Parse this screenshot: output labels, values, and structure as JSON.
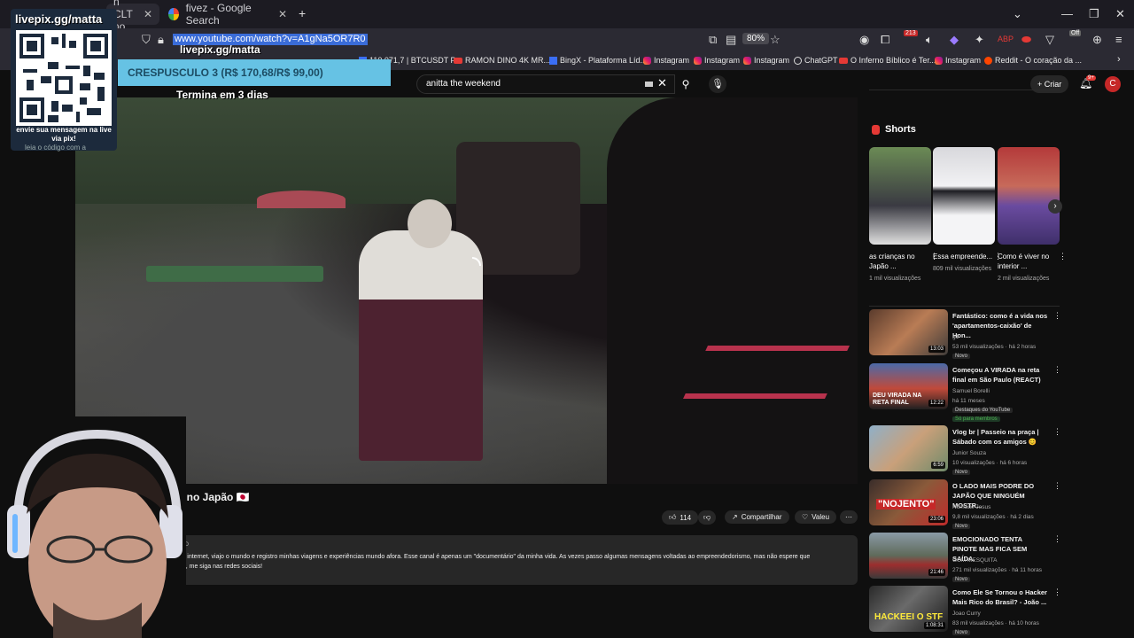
{
  "browser": {
    "tabs": [
      {
        "label": "n CLT no"
      },
      {
        "label": "fivez - Google Search"
      }
    ],
    "new_tab": "+",
    "url": "www.youtube.com/watch?v=A1gNa5OR7R0",
    "zoom": "80%",
    "ext_badge_1": "213",
    "ext_badge_2": "Off",
    "bookmarks": [
      {
        "label": "110.071,7 | BTCUSDT P...",
        "icon": "chart-icon"
      },
      {
        "label": "RAMON DINO 4K MR...",
        "icon": "youtube-icon"
      },
      {
        "label": "BingX - Plataforma Líd...",
        "icon": "bingx-icon"
      },
      {
        "label": "Instagram",
        "icon": "instagram-icon"
      },
      {
        "label": "Instagram",
        "icon": "instagram-icon"
      },
      {
        "label": "Instagram",
        "icon": "instagram-icon"
      },
      {
        "label": "ChatGPT",
        "icon": "chatgpt-icon"
      },
      {
        "label": "O Inferno Bíblico é Ter...",
        "icon": "youtube-icon"
      },
      {
        "label": "Instagram",
        "icon": "instagram-icon"
      },
      {
        "label": "Reddit - O coração da ...",
        "icon": "reddit-icon"
      }
    ]
  },
  "youtube": {
    "search_value": "anitta the weekend",
    "create_label": "Criar",
    "notif_count": "9+",
    "avatar_letter": "C",
    "video": {
      "title_fragment": "T no Japão 🇯🇵",
      "likes": "114",
      "share_label": "Compartilhar",
      "thanks_label": "Valeu",
      "desc_top": "OTO",
      "description": "ela internet, viajo o mundo e registro minhas viagens e experiências mundo afora. Esse canal é apenas um \"documentário\" da minha vida. As vezes passo algumas mensagens voltadas ao empreendedorismo, mas não espere que",
      "description_2": "rtiu, me siga nas redes sociais!"
    },
    "shorts_heading": "Shorts",
    "shorts": [
      {
        "title": "as crianças no Japão ...",
        "views": "1 mil visualizações"
      },
      {
        "title": "Essa empreende...",
        "views": "809 mil visualizações"
      },
      {
        "title": "Como é viver no interior ...",
        "views": "2 mil visualizações"
      }
    ],
    "recommended": [
      {
        "title": "Fantástico: como é a vida nos 'apartamentos-caixão' de Hon...",
        "channel": "g1",
        "meta": "53 mil visualizações · há 2 horas",
        "badge": "Novo",
        "duration": "13:03"
      },
      {
        "title": "Começou A VIRADA na reta final em São Paulo (REACT)",
        "channel": "Samuel Borelli",
        "meta": "há 11 meses",
        "badge": "Destaques do YouTube",
        "badge2": "Só para membros",
        "duration": "12:22",
        "thumb_text": "DEU VIRADA NA RETA FINAL"
      },
      {
        "title": "Vlog br | Passeio na praça | Sábado com os amigos 😊",
        "channel": "Junior Souza",
        "meta": "10 visualizações · há 6 horas",
        "badge": "Novo",
        "duration": "6:59"
      },
      {
        "title": "O LADO MAIS PODRE DO JAPÃO QUE NINGUÉM MOSTR...",
        "channel": "Nômade Jesus",
        "meta": "9,8 mil visualizações · há 2 dias",
        "badge": "Novo",
        "duration": "23:06",
        "thumb_text": "\"NOJENTO\""
      },
      {
        "title": "EMOCIONADO TENTA PINOTE MAS FICA SEM SAÍDA.",
        "channel": "GCM MESQUITA",
        "meta": "271 mil visualizações · há 11 horas",
        "badge": "Novo",
        "duration": "21:46"
      },
      {
        "title": "Como Ele Se Tornou o Hacker Mais Rico do Brasil? - João ...",
        "channel": "Joao Curry",
        "meta": "83 mil visualizações · há 10 horas",
        "badge": "Novo",
        "duration": "1:08:31",
        "thumb_text": "HACKEEI O STF"
      }
    ]
  },
  "overlay": {
    "qr_title": "livepix.gg/matta",
    "qr_caption": "envie sua mensagem na live via pix!",
    "qr_caption_2": "leia o código com a",
    "goal_url": "livepix.gg/matta",
    "goal_label": "CRESPUSCULO 3 (R$ 170,68/R$ 99,00)",
    "goal_progress": 1.0,
    "goal_subtitle": "Termina em 3 dias"
  }
}
